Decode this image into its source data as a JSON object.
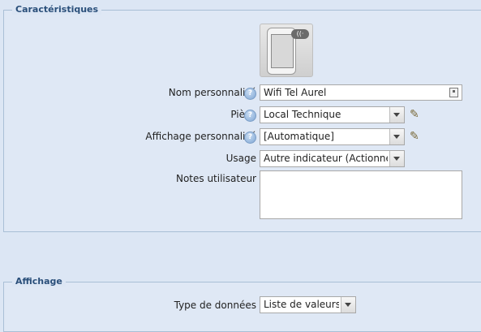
{
  "sections": {
    "characteristics": {
      "legend": "Caractéristiques"
    },
    "display": {
      "legend": "Affichage"
    }
  },
  "device": {
    "image_icon": "smartphone-wifi-icon",
    "wifi_badge": "Wifi"
  },
  "form": {
    "custom_name": {
      "label": "Nom personnalisé",
      "value": "Wifi Tel Aurel"
    },
    "room": {
      "label": "Pièce",
      "value": "Local Technique"
    },
    "custom_display": {
      "label": "Affichage personnalisé",
      "value": "[Automatique]"
    },
    "usage": {
      "label": "Usage",
      "value": "Autre indicateur (Actionneur)"
    },
    "notes": {
      "label": "Notes utilisateur",
      "value": ""
    },
    "data_type": {
      "label": "Type de données",
      "value": "Liste de valeurs"
    }
  },
  "icons": {
    "help": "help-icon",
    "edit": "pencil-icon"
  }
}
